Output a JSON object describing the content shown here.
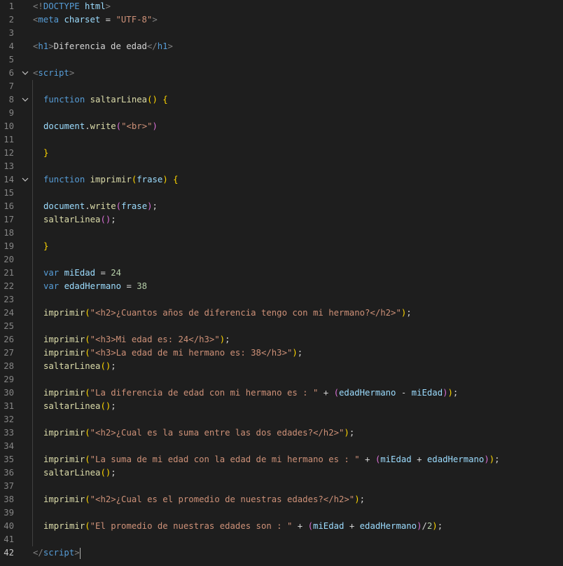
{
  "editor": {
    "cursor_line": 42,
    "fold_icon": "chevron-down-icon",
    "colors": {
      "background": "#1e1e1e",
      "tag": "#569cd6",
      "string": "#ce9178",
      "function": "#dcdcaa",
      "variable": "#9cdcfe",
      "number": "#b5cea8",
      "bracket": "#ffd700"
    },
    "lines": [
      {
        "num": "1",
        "fold": false,
        "indent": 0,
        "tokens": [
          {
            "c": "tag",
            "t": "<!"
          },
          {
            "c": "tn",
            "t": "DOCTYPE"
          },
          {
            "c": "txt",
            "t": " "
          },
          {
            "c": "at",
            "t": "html"
          },
          {
            "c": "tag",
            "t": ">"
          }
        ]
      },
      {
        "num": "2",
        "fold": false,
        "indent": 0,
        "tokens": [
          {
            "c": "tag",
            "t": "<"
          },
          {
            "c": "tn",
            "t": "meta"
          },
          {
            "c": "txt",
            "t": " "
          },
          {
            "c": "at",
            "t": "charset"
          },
          {
            "c": "txt",
            "t": " = "
          },
          {
            "c": "str",
            "t": "\"UTF-8\""
          },
          {
            "c": "tag",
            "t": ">"
          }
        ]
      },
      {
        "num": "3",
        "fold": false,
        "indent": 0,
        "tokens": []
      },
      {
        "num": "4",
        "fold": false,
        "indent": 0,
        "tokens": [
          {
            "c": "tag",
            "t": "<"
          },
          {
            "c": "tn",
            "t": "h1"
          },
          {
            "c": "tag",
            "t": ">"
          },
          {
            "c": "txt",
            "t": "Diferencia de edad"
          },
          {
            "c": "tag",
            "t": "</"
          },
          {
            "c": "tn",
            "t": "h1"
          },
          {
            "c": "tag",
            "t": ">"
          }
        ]
      },
      {
        "num": "5",
        "fold": false,
        "indent": 0,
        "tokens": []
      },
      {
        "num": "6",
        "fold": true,
        "indent": 0,
        "tokens": [
          {
            "c": "tag",
            "t": "<"
          },
          {
            "c": "tn",
            "t": "script"
          },
          {
            "c": "tag",
            "t": ">"
          }
        ]
      },
      {
        "num": "7",
        "fold": false,
        "indent": 0,
        "tokens": []
      },
      {
        "num": "8",
        "fold": true,
        "indent": 1,
        "tokens": [
          {
            "c": "kw",
            "t": "function"
          },
          {
            "c": "txt",
            "t": " "
          },
          {
            "c": "fn",
            "t": "saltarLinea"
          },
          {
            "c": "br1",
            "t": "()"
          },
          {
            "c": "txt",
            "t": " "
          },
          {
            "c": "br1",
            "t": "{"
          }
        ]
      },
      {
        "num": "9",
        "fold": false,
        "indent": 0,
        "tokens": []
      },
      {
        "num": "10",
        "fold": false,
        "indent": 1,
        "tokens": [
          {
            "c": "vr",
            "t": "document"
          },
          {
            "c": "txt",
            "t": "."
          },
          {
            "c": "fn",
            "t": "write"
          },
          {
            "c": "br2",
            "t": "("
          },
          {
            "c": "str",
            "t": "\"<br>\""
          },
          {
            "c": "br2",
            "t": ")"
          }
        ]
      },
      {
        "num": "11",
        "fold": false,
        "indent": 0,
        "tokens": []
      },
      {
        "num": "12",
        "fold": false,
        "indent": 1,
        "tokens": [
          {
            "c": "br1",
            "t": "}"
          }
        ]
      },
      {
        "num": "13",
        "fold": false,
        "indent": 0,
        "tokens": []
      },
      {
        "num": "14",
        "fold": true,
        "indent": 1,
        "tokens": [
          {
            "c": "kw",
            "t": "function"
          },
          {
            "c": "txt",
            "t": " "
          },
          {
            "c": "fn",
            "t": "imprimir"
          },
          {
            "c": "br1",
            "t": "("
          },
          {
            "c": "vr",
            "t": "frase"
          },
          {
            "c": "br1",
            "t": ")"
          },
          {
            "c": "txt",
            "t": " "
          },
          {
            "c": "br1",
            "t": "{"
          }
        ]
      },
      {
        "num": "15",
        "fold": false,
        "indent": 0,
        "tokens": []
      },
      {
        "num": "16",
        "fold": false,
        "indent": 1,
        "tokens": [
          {
            "c": "vr",
            "t": "document"
          },
          {
            "c": "txt",
            "t": "."
          },
          {
            "c": "fn",
            "t": "write"
          },
          {
            "c": "br2",
            "t": "("
          },
          {
            "c": "vr",
            "t": "frase"
          },
          {
            "c": "br2",
            "t": ")"
          },
          {
            "c": "txt",
            "t": ";"
          }
        ]
      },
      {
        "num": "17",
        "fold": false,
        "indent": 1,
        "tokens": [
          {
            "c": "fn",
            "t": "saltarLinea"
          },
          {
            "c": "br2",
            "t": "()"
          },
          {
            "c": "txt",
            "t": ";"
          }
        ]
      },
      {
        "num": "18",
        "fold": false,
        "indent": 0,
        "tokens": []
      },
      {
        "num": "19",
        "fold": false,
        "indent": 1,
        "tokens": [
          {
            "c": "br1",
            "t": "}"
          }
        ]
      },
      {
        "num": "20",
        "fold": false,
        "indent": 0,
        "tokens": []
      },
      {
        "num": "21",
        "fold": false,
        "indent": 1,
        "tokens": [
          {
            "c": "kw",
            "t": "var"
          },
          {
            "c": "txt",
            "t": " "
          },
          {
            "c": "vr",
            "t": "miEdad"
          },
          {
            "c": "txt",
            "t": " = "
          },
          {
            "c": "num",
            "t": "24"
          }
        ]
      },
      {
        "num": "22",
        "fold": false,
        "indent": 1,
        "tokens": [
          {
            "c": "kw",
            "t": "var"
          },
          {
            "c": "txt",
            "t": " "
          },
          {
            "c": "vr",
            "t": "edadHermano"
          },
          {
            "c": "txt",
            "t": " = "
          },
          {
            "c": "num",
            "t": "38"
          }
        ]
      },
      {
        "num": "23",
        "fold": false,
        "indent": 0,
        "tokens": []
      },
      {
        "num": "24",
        "fold": false,
        "indent": 1,
        "tokens": [
          {
            "c": "fn",
            "t": "imprimir"
          },
          {
            "c": "br1",
            "t": "("
          },
          {
            "c": "str",
            "t": "\"<h2>¿Cuantos años de diferencia tengo con mi hermano?</h2>\""
          },
          {
            "c": "br1",
            "t": ")"
          },
          {
            "c": "txt",
            "t": ";"
          }
        ]
      },
      {
        "num": "25",
        "fold": false,
        "indent": 0,
        "tokens": []
      },
      {
        "num": "26",
        "fold": false,
        "indent": 1,
        "tokens": [
          {
            "c": "fn",
            "t": "imprimir"
          },
          {
            "c": "br1",
            "t": "("
          },
          {
            "c": "str",
            "t": "\"<h3>Mi edad es: 24</h3>\""
          },
          {
            "c": "br1",
            "t": ")"
          },
          {
            "c": "txt",
            "t": ";"
          }
        ]
      },
      {
        "num": "27",
        "fold": false,
        "indent": 1,
        "tokens": [
          {
            "c": "fn",
            "t": "imprimir"
          },
          {
            "c": "br1",
            "t": "("
          },
          {
            "c": "str",
            "t": "\"<h3>La edad de mi hermano es: 38</h3>\""
          },
          {
            "c": "br1",
            "t": ")"
          },
          {
            "c": "txt",
            "t": ";"
          }
        ]
      },
      {
        "num": "28",
        "fold": false,
        "indent": 1,
        "tokens": [
          {
            "c": "fn",
            "t": "saltarLinea"
          },
          {
            "c": "br1",
            "t": "()"
          },
          {
            "c": "txt",
            "t": ";"
          }
        ]
      },
      {
        "num": "29",
        "fold": false,
        "indent": 0,
        "tokens": []
      },
      {
        "num": "30",
        "fold": false,
        "indent": 1,
        "tokens": [
          {
            "c": "fn",
            "t": "imprimir"
          },
          {
            "c": "br1",
            "t": "("
          },
          {
            "c": "str",
            "t": "\"La diferencia de edad con mi hermano es : \""
          },
          {
            "c": "txt",
            "t": " + "
          },
          {
            "c": "br2",
            "t": "("
          },
          {
            "c": "vr",
            "t": "edadHermano"
          },
          {
            "c": "txt",
            "t": " - "
          },
          {
            "c": "vr",
            "t": "miEdad"
          },
          {
            "c": "br2",
            "t": ")"
          },
          {
            "c": "br1",
            "t": ")"
          },
          {
            "c": "txt",
            "t": ";"
          }
        ]
      },
      {
        "num": "31",
        "fold": false,
        "indent": 1,
        "tokens": [
          {
            "c": "fn",
            "t": "saltarLinea"
          },
          {
            "c": "br1",
            "t": "()"
          },
          {
            "c": "txt",
            "t": ";"
          }
        ]
      },
      {
        "num": "32",
        "fold": false,
        "indent": 0,
        "tokens": []
      },
      {
        "num": "33",
        "fold": false,
        "indent": 1,
        "tokens": [
          {
            "c": "fn",
            "t": "imprimir"
          },
          {
            "c": "br1",
            "t": "("
          },
          {
            "c": "str",
            "t": "\"<h2>¿Cual es la suma entre las dos edades?</h2>\""
          },
          {
            "c": "br1",
            "t": ")"
          },
          {
            "c": "txt",
            "t": ";"
          }
        ]
      },
      {
        "num": "34",
        "fold": false,
        "indent": 0,
        "tokens": []
      },
      {
        "num": "35",
        "fold": false,
        "indent": 1,
        "tokens": [
          {
            "c": "fn",
            "t": "imprimir"
          },
          {
            "c": "br1",
            "t": "("
          },
          {
            "c": "str",
            "t": "\"La suma de mi edad con la edad de mi hermano es : \""
          },
          {
            "c": "txt",
            "t": " + "
          },
          {
            "c": "br2",
            "t": "("
          },
          {
            "c": "vr",
            "t": "miEdad"
          },
          {
            "c": "txt",
            "t": " + "
          },
          {
            "c": "vr",
            "t": "edadHermano"
          },
          {
            "c": "br2",
            "t": ")"
          },
          {
            "c": "br1",
            "t": ")"
          },
          {
            "c": "txt",
            "t": ";"
          }
        ]
      },
      {
        "num": "36",
        "fold": false,
        "indent": 1,
        "tokens": [
          {
            "c": "fn",
            "t": "saltarLinea"
          },
          {
            "c": "br1",
            "t": "()"
          },
          {
            "c": "txt",
            "t": ";"
          }
        ]
      },
      {
        "num": "37",
        "fold": false,
        "indent": 0,
        "tokens": []
      },
      {
        "num": "38",
        "fold": false,
        "indent": 1,
        "tokens": [
          {
            "c": "fn",
            "t": "imprimir"
          },
          {
            "c": "br1",
            "t": "("
          },
          {
            "c": "str",
            "t": "\"<h2>¿Cual es el promedio de nuestras edades?</h2>\""
          },
          {
            "c": "br1",
            "t": ")"
          },
          {
            "c": "txt",
            "t": ";"
          }
        ]
      },
      {
        "num": "39",
        "fold": false,
        "indent": 0,
        "tokens": []
      },
      {
        "num": "40",
        "fold": false,
        "indent": 1,
        "tokens": [
          {
            "c": "fn",
            "t": "imprimir"
          },
          {
            "c": "br1",
            "t": "("
          },
          {
            "c": "str",
            "t": "\"El promedio de nuestras edades son : \""
          },
          {
            "c": "txt",
            "t": " + "
          },
          {
            "c": "br2",
            "t": "("
          },
          {
            "c": "vr",
            "t": "miEdad"
          },
          {
            "c": "txt",
            "t": " + "
          },
          {
            "c": "vr",
            "t": "edadHermano"
          },
          {
            "c": "br2",
            "t": ")"
          },
          {
            "c": "txt",
            "t": "/"
          },
          {
            "c": "num",
            "t": "2"
          },
          {
            "c": "br1",
            "t": ")"
          },
          {
            "c": "txt",
            "t": ";"
          }
        ]
      },
      {
        "num": "41",
        "fold": false,
        "indent": 0,
        "tokens": []
      },
      {
        "num": "42",
        "fold": false,
        "indent": 0,
        "tokens": [
          {
            "c": "tag",
            "t": "</"
          },
          {
            "c": "tn",
            "t": "script"
          },
          {
            "c": "tag",
            "t": ">"
          }
        ]
      }
    ]
  }
}
